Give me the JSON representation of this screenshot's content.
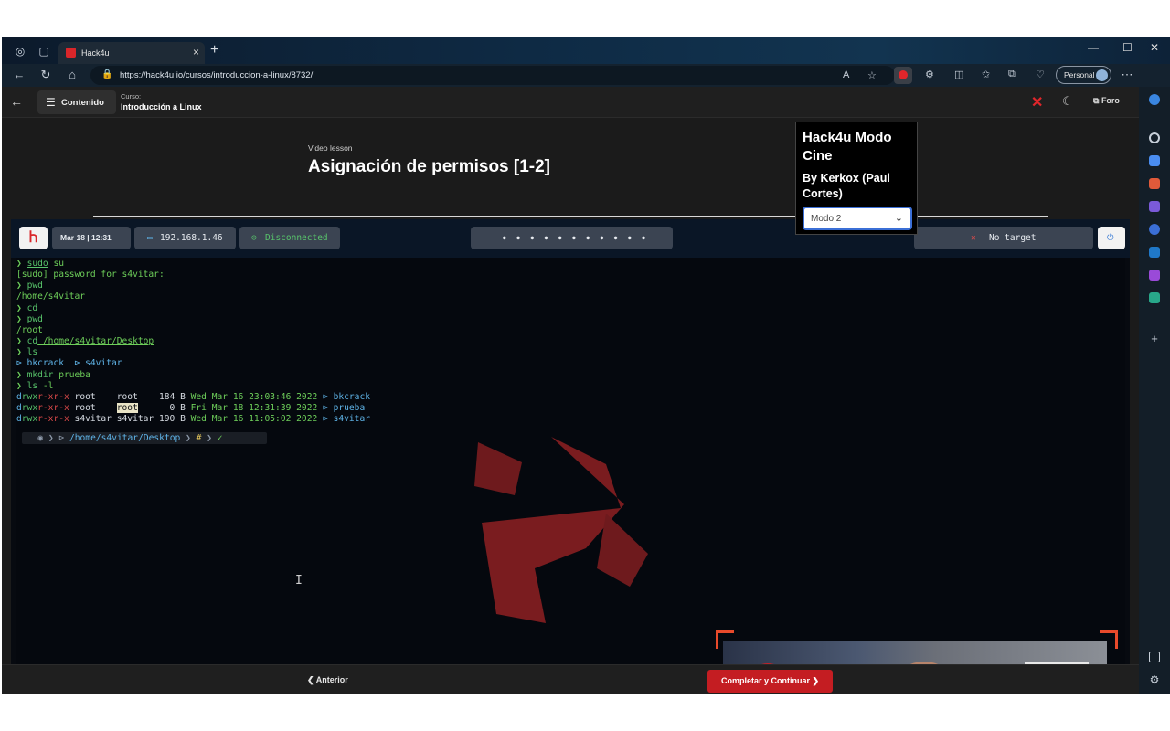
{
  "browser": {
    "tab_title": "Hack4u",
    "tab_close": "×",
    "new_tab": "+",
    "url": "https://hack4u.io/cursos/introduccion-a-linux/8732/",
    "profile_label": "Personal",
    "window_min": "—",
    "window_max": "☐",
    "window_close": "✕"
  },
  "header": {
    "contenido_label": "Contenido",
    "curso_key": "Curso:",
    "curso_value": "Introducción a Linux",
    "foro_label": "Foro"
  },
  "lesson": {
    "type": "Video lesson",
    "title": "Asignación de permisos [1-2]"
  },
  "video_bar": {
    "datetime": "Mar 18 | 12:31",
    "ip": "192.168.1.46",
    "vpn_status": "Disconnected",
    "dots": "● ● ● ● ● ● ● ● ● ● ●",
    "target": "No target"
  },
  "terminal": {
    "lines": [
      {
        "p": "❯ ",
        "cmd": "sudo",
        "rest": " su"
      },
      {
        "text": "[sudo] password for s4vitar:"
      },
      {
        "p": "❯ ",
        "cmd": "pwd",
        "rest": ""
      },
      {
        "text": "/home/s4vitar"
      },
      {
        "p": "❯ ",
        "cmd": "cd",
        "rest": ""
      },
      {
        "p": "❯ ",
        "cmd": "pwd",
        "rest": ""
      },
      {
        "text": "/root"
      },
      {
        "p": "❯ ",
        "cmd": "cd",
        "rest": " /home/s4vitar/Desktop"
      },
      {
        "p": "❯ ",
        "cmd": "ls",
        "rest": ""
      },
      {
        "text": "⊳ bkcrack  ⊳ s4vitar"
      },
      {
        "p": "❯ ",
        "cmd": "mkdir",
        "rest": " prueba"
      },
      {
        "p": "❯ ",
        "cmd": "ls",
        "rest": " -l"
      }
    ],
    "listing": [
      {
        "perm": "drwxr-xr-x",
        "owner": "root   ",
        "group": "root   ",
        "size": " 184 B",
        "date": "Wed Mar 16 23:03:46 2022",
        "name": "bkcrack"
      },
      {
        "perm": "drwxr-xr-x",
        "owner": "root   ",
        "group": "root   ",
        "size": "   0 B",
        "date": "Fri Mar 18 12:31:39 2022",
        "name": "prueba"
      },
      {
        "perm": "drwxr-xr-x",
        "owner": "s4vitar",
        "group": "s4vitar",
        "size": " 190 B",
        "date": "Wed Mar 16 11:05:02 2022",
        "name": "s4vitar"
      }
    ],
    "prompt_path": "/home/s4vitar/Desktop",
    "prompt_hash": "#",
    "prompt_check": "✓"
  },
  "footer": {
    "prev_label": "Anterior",
    "next_label": "Completar y Continuar"
  },
  "popup": {
    "title": "Hack4u Modo Cine",
    "author": "By Kerkox (Paul Cortes)",
    "select_value": "Modo 2"
  },
  "colors": {
    "accent_red": "#c41d22",
    "terminal_green": "#6ecf5a",
    "terminal_blue": "#5fb4e8"
  }
}
